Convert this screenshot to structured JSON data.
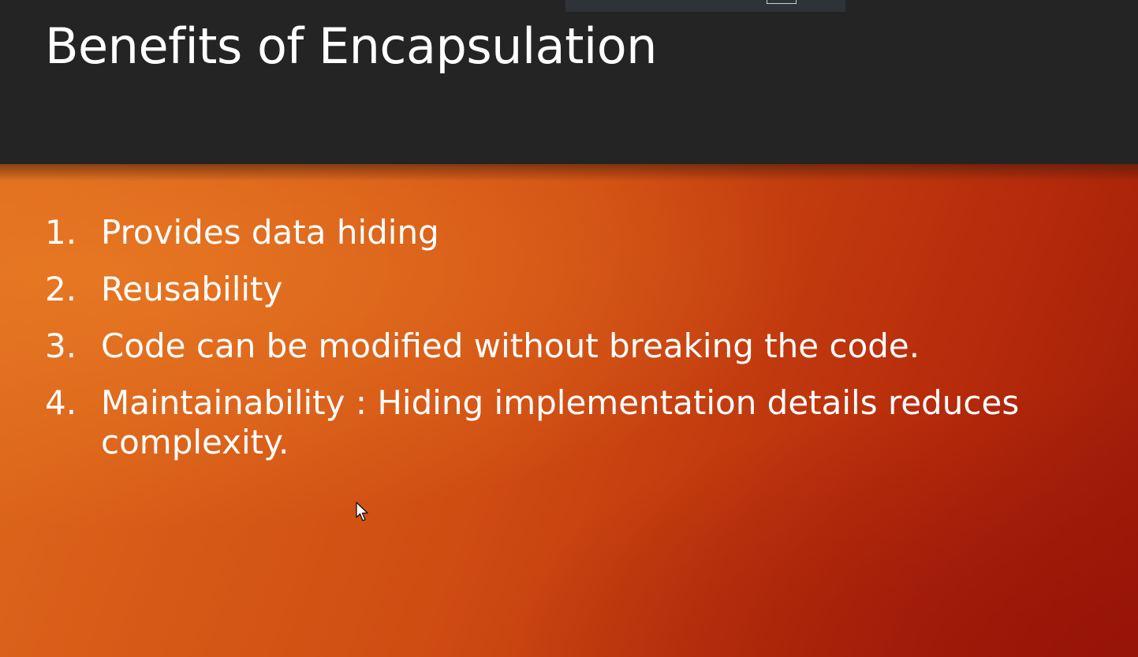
{
  "slide": {
    "title": "Benefits of Encapsulation",
    "items": [
      {
        "number": "1.",
        "text": "Provides data hiding"
      },
      {
        "number": "2.",
        "text": "Reusability"
      },
      {
        "number": "3.",
        "text": "Code can be modified without breaking the code."
      },
      {
        "number": "4.",
        "text": "Maintainability : Hiding implementation details reduces complexity."
      }
    ]
  },
  "icons": {
    "cursor": "mouse-pointer-icon"
  },
  "colors": {
    "title_bar": "#242424",
    "content_gradient_start": "#de6a1d",
    "content_gradient_end": "#9c1a08",
    "text": "#ffffff"
  }
}
